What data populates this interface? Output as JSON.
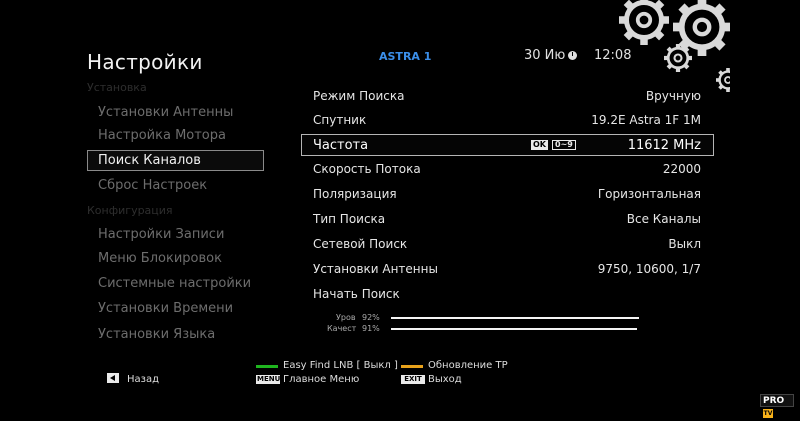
{
  "header": {
    "title": "Настройки",
    "satellite": "ASTRA 1",
    "date": "30 Ию",
    "time": "12:08"
  },
  "sidebar": {
    "section1": "Установка",
    "section2": "Конфигурация",
    "items": [
      {
        "label": "Установки Антенны"
      },
      {
        "label": "Настройка Мотора"
      },
      {
        "label": "Поиск Каналов"
      },
      {
        "label": "Сброс Настроек"
      },
      {
        "label": "Настройки Записи"
      },
      {
        "label": "Меню Блокировок"
      },
      {
        "label": "Системные настройки"
      },
      {
        "label": "Установки Времени"
      },
      {
        "label": "Установки Языка"
      }
    ]
  },
  "settings": {
    "rows": [
      {
        "label": "Режим Поиска",
        "value": "Вручную"
      },
      {
        "label": "Спутник",
        "value": "19.2E Astra 1F 1M"
      },
      {
        "label": "Частота",
        "value": "11612 MHz"
      },
      {
        "label": "Скорость Потока",
        "value": "22000"
      },
      {
        "label": "Поляризация",
        "value": "Горизонтальная"
      },
      {
        "label": "Тип Поиска",
        "value": "Все Каналы"
      },
      {
        "label": "Сетевой Поиск",
        "value": "Выкл"
      },
      {
        "label": "Установки Антенны",
        "value": "9750, 10600, 1/7"
      },
      {
        "label": "Начать Поиск",
        "value": ""
      }
    ],
    "ok_badge": "OK",
    "range_badge": "0~9"
  },
  "signal": {
    "level_label": "Уров",
    "level_value": "92%",
    "level_fraction": 0.92,
    "quality_label": "Качест",
    "quality_value": "91%",
    "quality_fraction": 0.91
  },
  "footer": {
    "back": "Назад",
    "green_label": "Easy Find LNB [ Выкл ]",
    "yellow_label": "Обновление TP",
    "menu_key": "MENU",
    "menu_label": "Главное Меню",
    "exit_key": "EXIT",
    "exit_label": "Выход",
    "green_color": "#1fb51f",
    "yellow_color": "#e8a21b"
  },
  "watermark": {
    "text": "PRO",
    "badge": "TV"
  },
  "icons": {
    "gears": "gears-icon",
    "clock": "clock-icon",
    "back": "back-arrow-icon"
  }
}
